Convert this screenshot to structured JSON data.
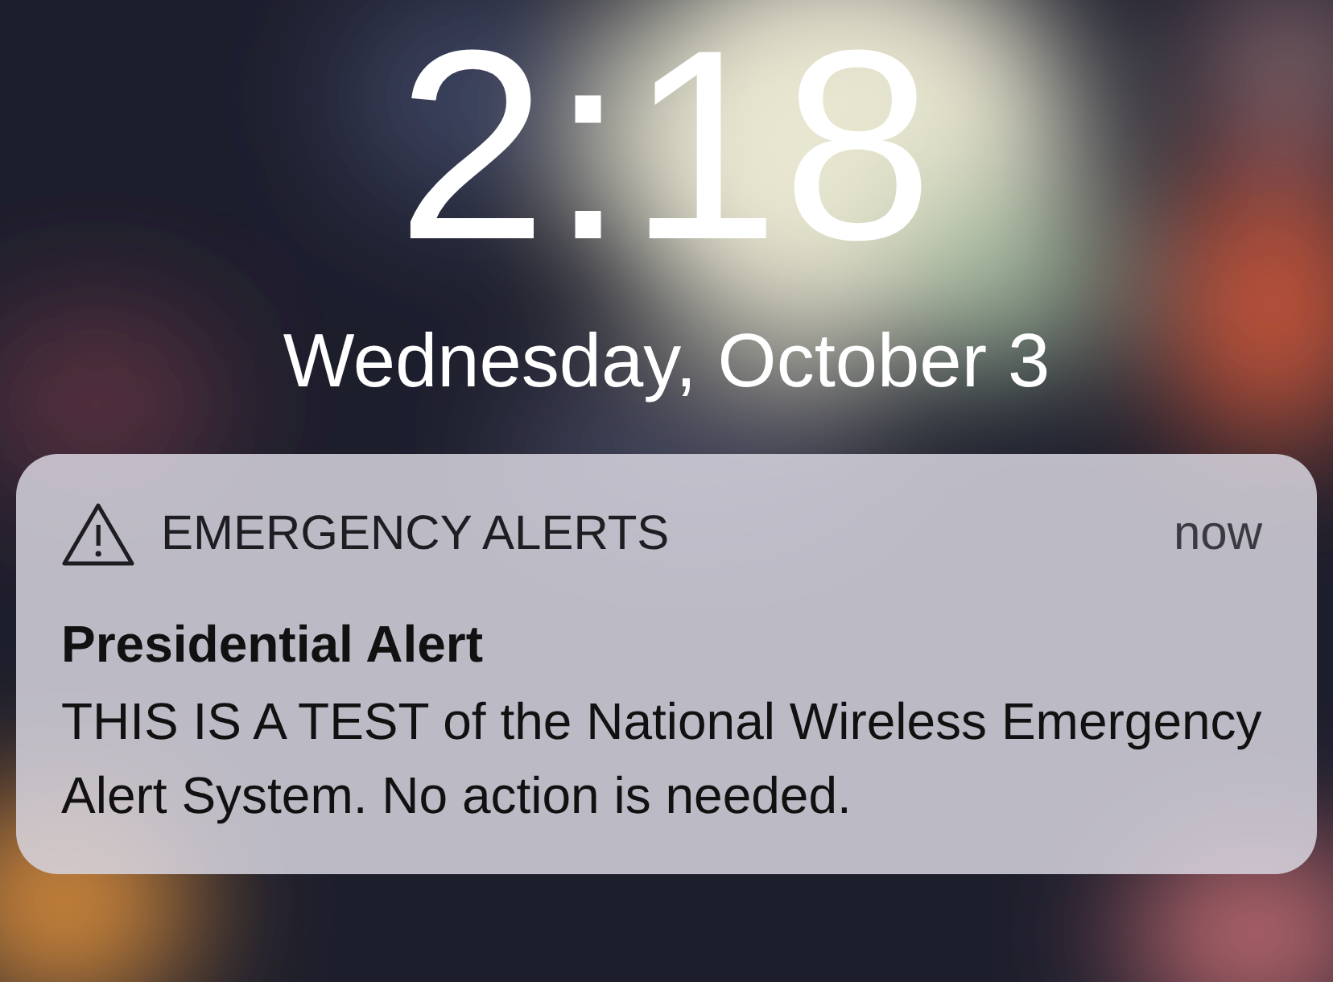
{
  "clock": {
    "time": "2:18",
    "date": "Wednesday, October 3"
  },
  "notification": {
    "app": "EMERGENCY ALERTS",
    "time": "now",
    "title": "Presidential Alert",
    "body": "THIS IS A TEST of the National Wireless Emergency Alert System. No action is needed."
  }
}
